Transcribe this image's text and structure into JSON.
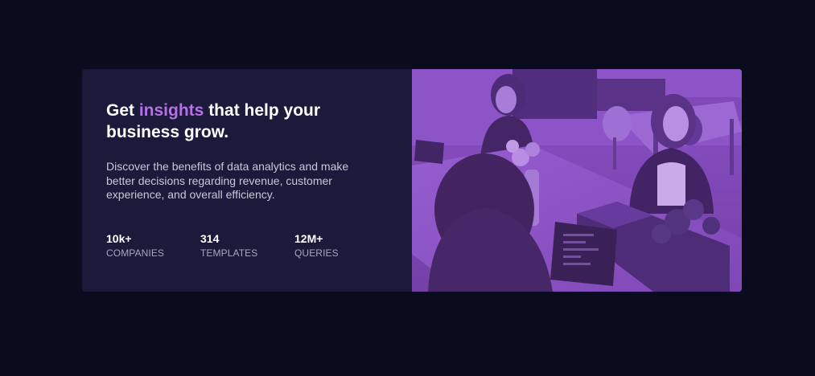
{
  "feature": {
    "headline_before": "Get ",
    "headline_accent": "insights",
    "headline_after": " that help your business grow.",
    "description": "Discover the benefits of data analytics and make better decisions regarding revenue, customer experience, and overall efficiency.",
    "stats": [
      {
        "value": "10k+",
        "label": "COMPANIES"
      },
      {
        "value": "314",
        "label": "TEMPLATES"
      },
      {
        "value": "12M+",
        "label": "QUERIES"
      }
    ]
  },
  "colors": {
    "page_background": "#090c1c",
    "card_background": "#1b1a3a",
    "accent": "#b76ee6",
    "photo_tint": "#8a4fc4"
  }
}
